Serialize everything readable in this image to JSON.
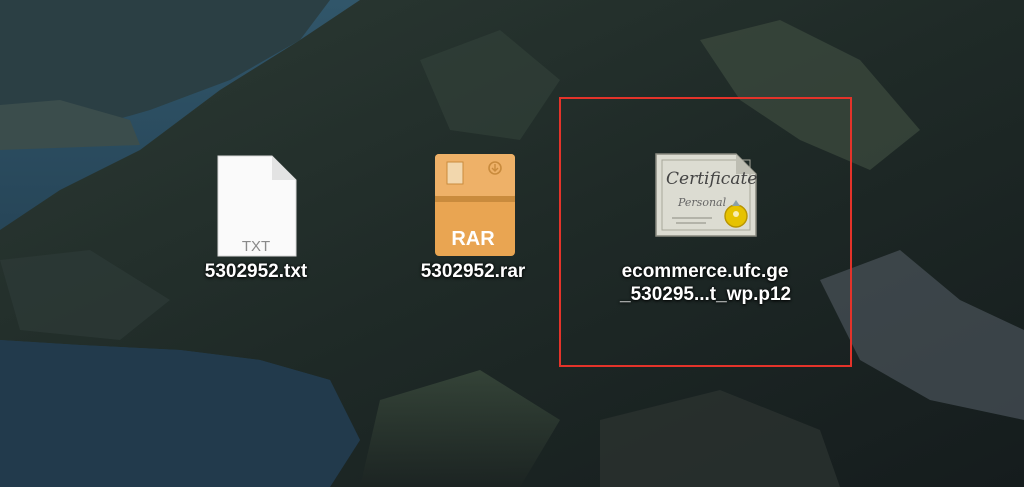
{
  "desktop": {
    "files": [
      {
        "name": "5302952.txt",
        "kind": "text-file-icon",
        "icon_text": "TXT"
      },
      {
        "name": "5302952.rar",
        "kind": "rar-archive-icon",
        "icon_text": "RAR"
      },
      {
        "name": "ecommerce.ufc.ge_530295...t_wp.p12",
        "name_line1": "ecommerce.ufc.ge",
        "name_line2": "_530295...t_wp.p12",
        "kind": "certificate-icon",
        "icon_text_line1": "Certificate",
        "icon_text_line2": "Personal"
      }
    ]
  },
  "highlight": {
    "color": "#e4332a",
    "target": "ecommerce.ufc.ge_530295...t_wp.p12"
  }
}
